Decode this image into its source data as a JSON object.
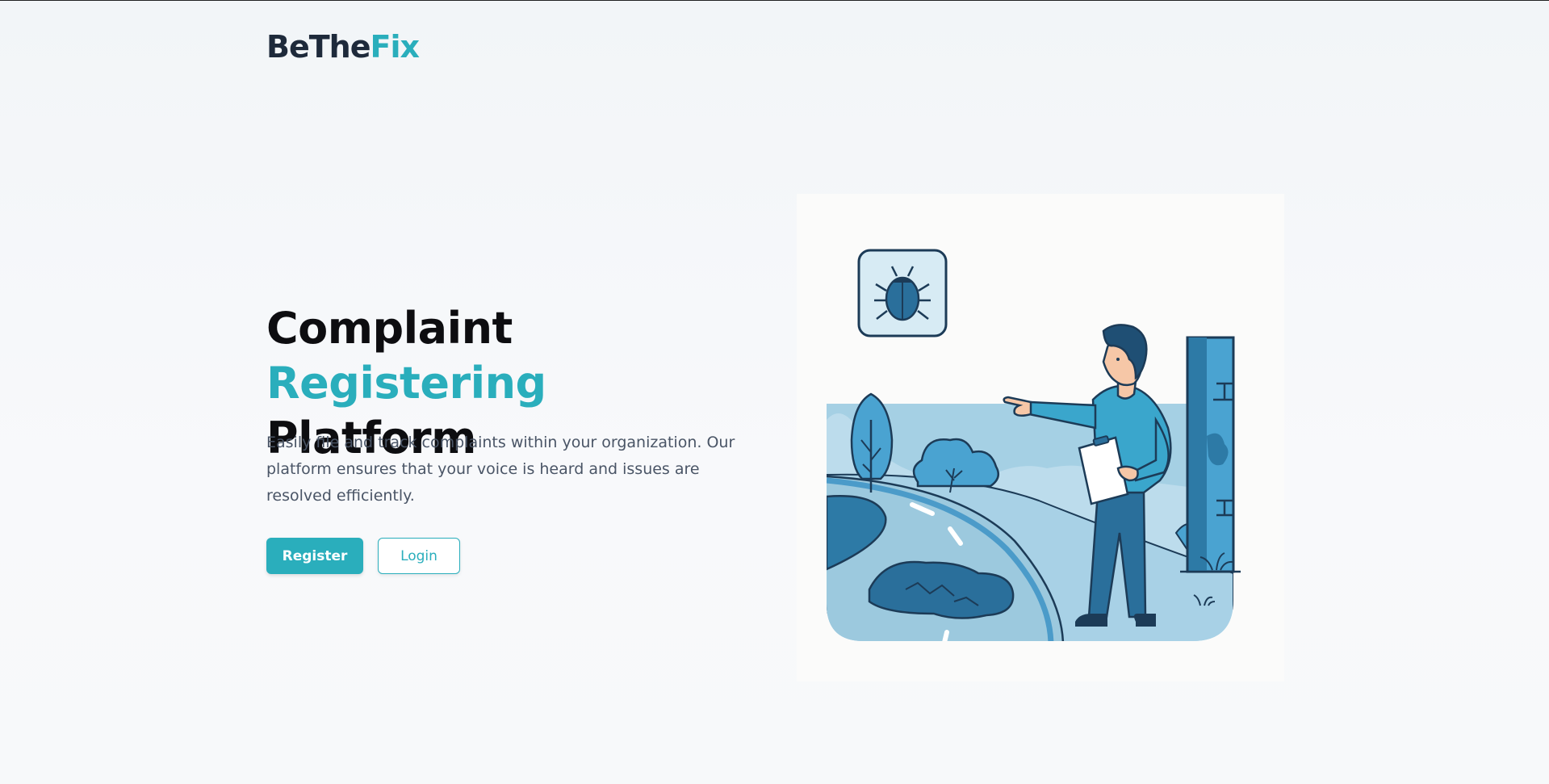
{
  "brand": {
    "name_part1": "BeThe",
    "name_part2": "Fix"
  },
  "hero": {
    "title_part1": "Complaint ",
    "title_accent": "Registering",
    "title_part2": "Platform",
    "description": "Easily file and track complaints within your organization. Our platform ensures that your voice is heard and issues are resolved efficiently."
  },
  "actions": {
    "register_label": "Register",
    "login_label": "Login"
  },
  "colors": {
    "accent": "#2aaebc",
    "heading": "#0d0d10",
    "logo_dark": "#1e2a3b",
    "body_text": "#4a5566"
  },
  "illustration": {
    "name": "person-reporting-bug-illustration"
  }
}
